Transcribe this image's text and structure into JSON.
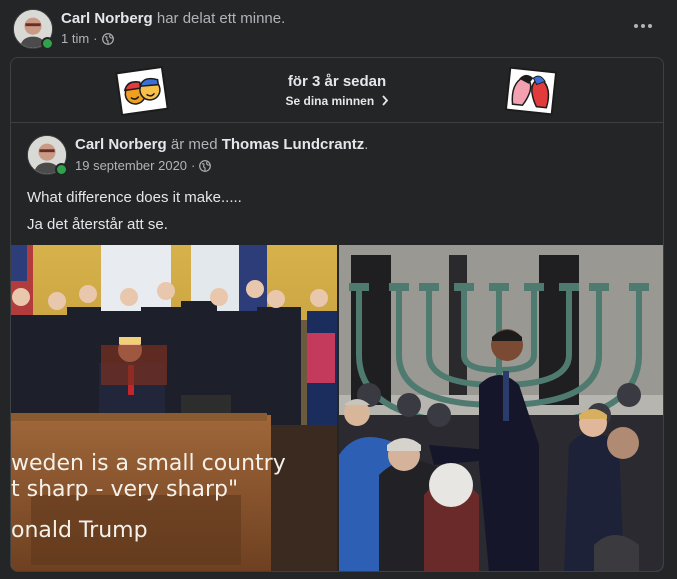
{
  "post": {
    "author": "Carl Norberg",
    "action": "har delat ett minne.",
    "time": "1 tim",
    "separator": "·",
    "privacy_icon": "globe-icon",
    "more_icon": "more-horizontal-icon"
  },
  "memory": {
    "title": "för 3 år sedan",
    "link_label": "Se dina minnen",
    "link_icon": "chevron-right-icon"
  },
  "original_post": {
    "author": "Carl Norberg",
    "with_text": "är med",
    "tagged": "Thomas Lundcrantz",
    "period": ".",
    "date": "19 september 2020",
    "separator": "·",
    "privacy_icon": "globe-icon",
    "lines": [
      "What difference does it make.....",
      "Ja det återstår att se."
    ]
  },
  "photo_left": {
    "caption_lines": [
      "weden is a small country",
      "t sharp - very sharp\"",
      "onald Trump"
    ]
  },
  "colors": {
    "background": "#242526",
    "text_primary": "#e4e6eb",
    "text_secondary": "#b0b3b8",
    "border": "#3e4042",
    "online": "#31a24c"
  }
}
